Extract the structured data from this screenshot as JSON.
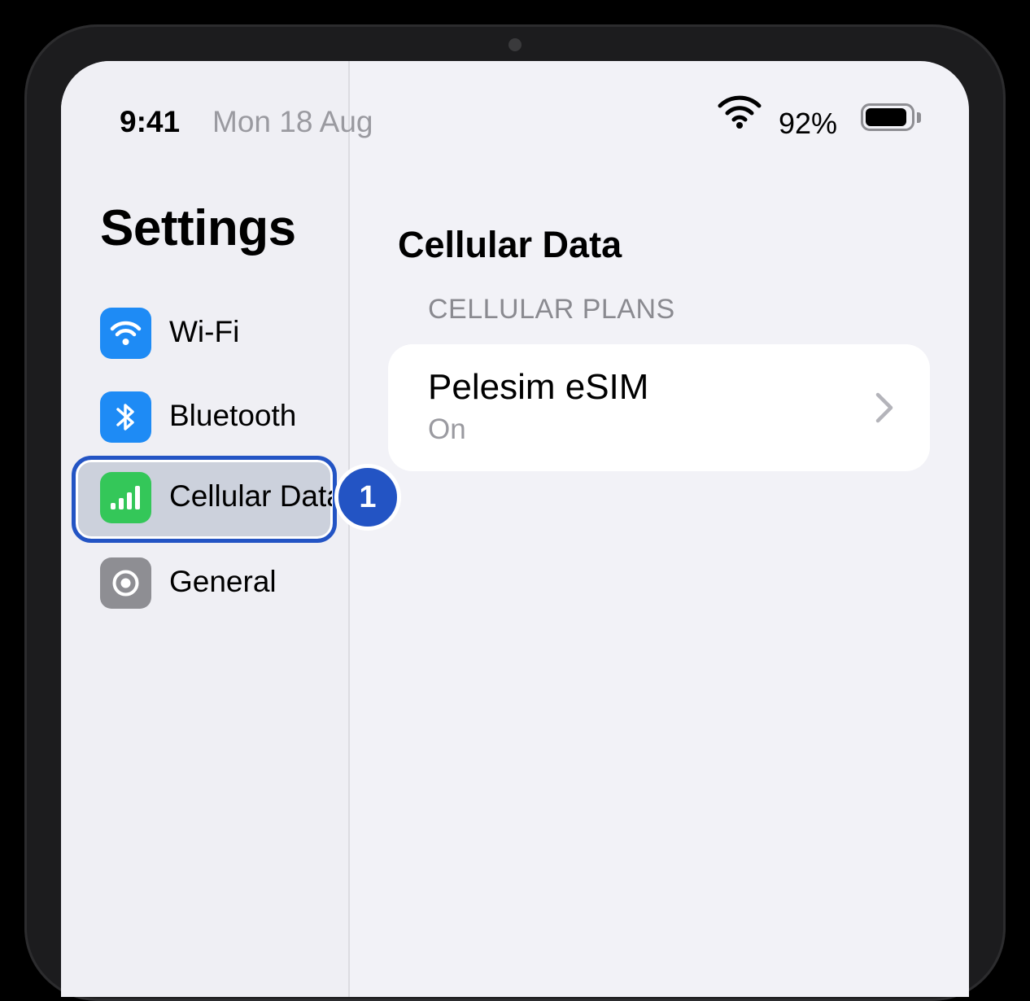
{
  "status_bar": {
    "time": "9:41",
    "date": "Mon 18 Aug",
    "battery_percent": "92%",
    "battery_level": 0.92,
    "wifi_icon": "wifi-icon",
    "battery_icon": "battery-icon"
  },
  "sidebar": {
    "title": "Settings",
    "items": [
      {
        "label": "Wi-Fi",
        "icon": "wifi-icon",
        "icon_color": "#1e8bf5"
      },
      {
        "label": "Bluetooth",
        "icon": "bluetooth-icon",
        "icon_color": "#1e8bf5"
      },
      {
        "label": "Cellular Data",
        "icon": "cellular-icon",
        "icon_color": "#34c759",
        "selected": true
      },
      {
        "label": "General",
        "icon": "gear-icon",
        "icon_color": "#8e8e93"
      }
    ]
  },
  "annotation": {
    "step_number": "1",
    "color": "#2354c4"
  },
  "detail": {
    "title": "Cellular Data",
    "section_header": "CELLULAR PLANS",
    "plans": [
      {
        "name": "Pelesim eSIM",
        "status": "On",
        "icon": "chevron-right-icon"
      }
    ]
  }
}
